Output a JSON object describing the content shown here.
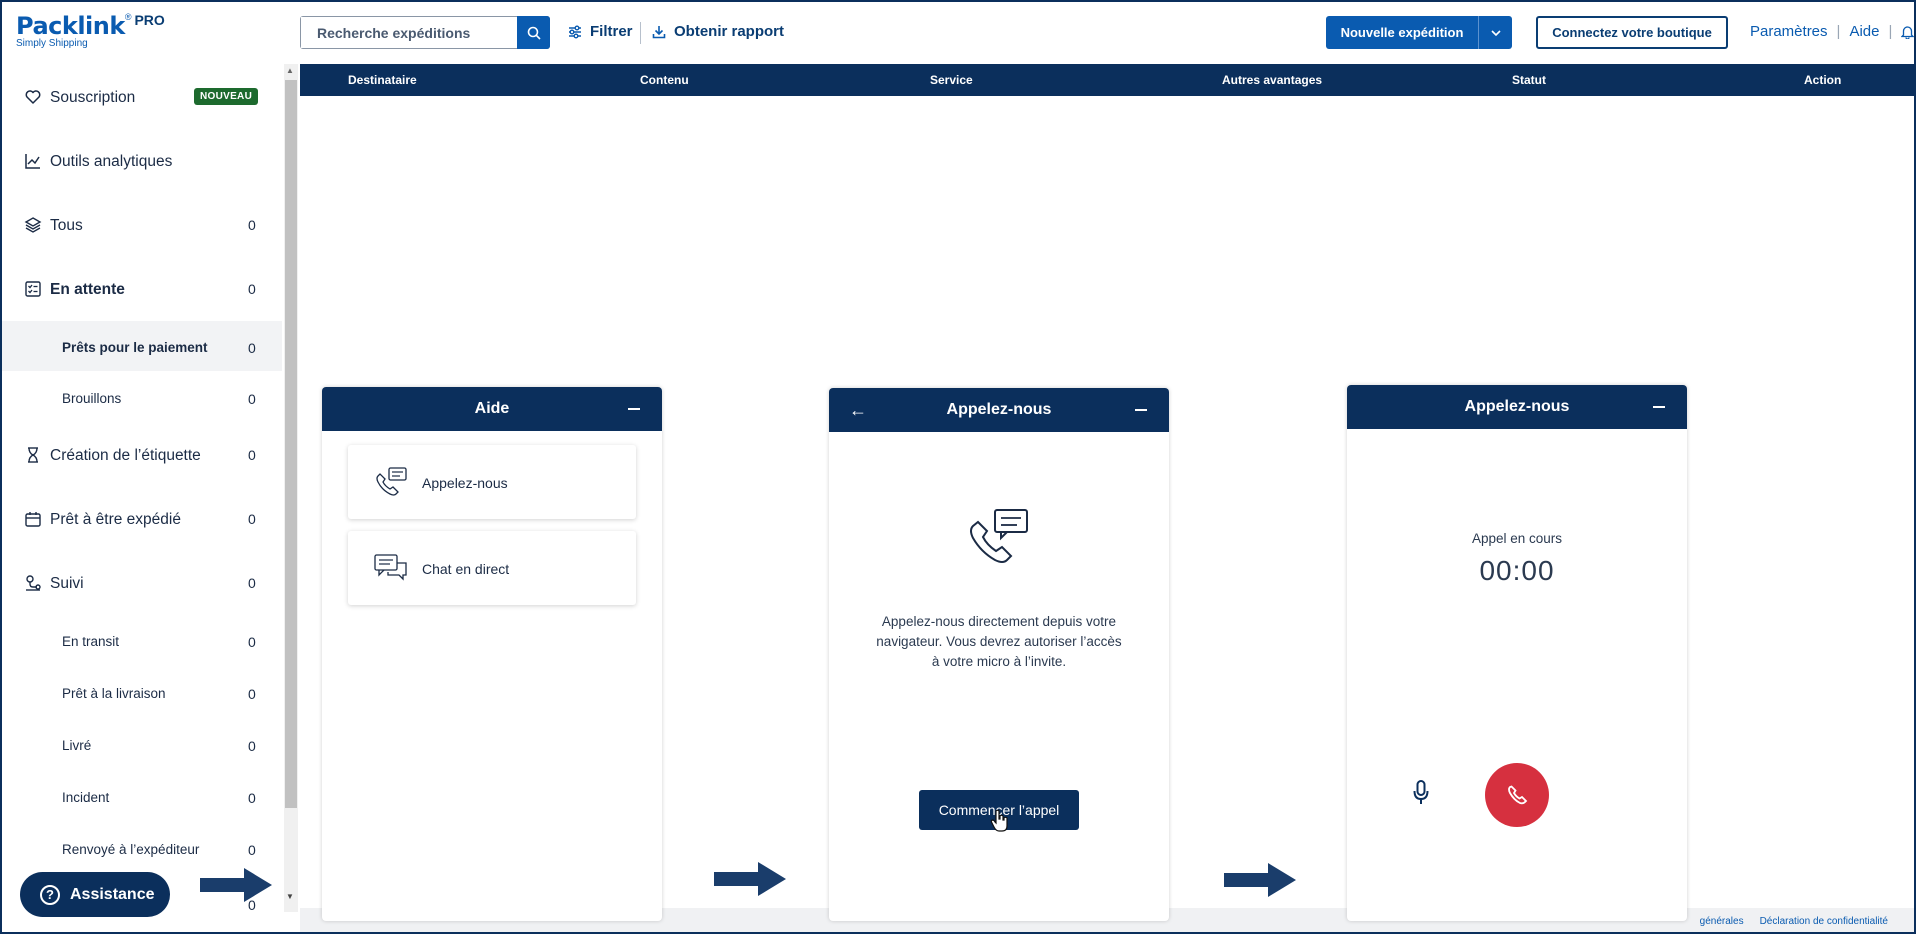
{
  "header": {
    "logo": "Packlink",
    "logo_pro": "PRO",
    "logo_tagline": "Simply Shipping",
    "search_placeholder": "Recherche expéditions",
    "filter_label": "Filtrer",
    "report_label": "Obtenir rapport",
    "new_shipment_label": "Nouvelle expédition",
    "connect_shop_label": "Connectez votre boutique",
    "settings_label": "Paramètres",
    "help_label": "Aide"
  },
  "table": {
    "columns": [
      "Destinataire",
      "Contenu",
      "Service",
      "Autres avantages",
      "Statut",
      "Action"
    ]
  },
  "sidebar": {
    "badge": "NOUVEAU",
    "items": [
      {
        "label": "Souscription",
        "count": ""
      },
      {
        "label": "Outils analytiques",
        "count": ""
      },
      {
        "label": "Tous",
        "count": "0"
      },
      {
        "label": "En attente",
        "count": "0"
      },
      {
        "label": "Prêts pour le paiement",
        "count": "0"
      },
      {
        "label": "Brouillons",
        "count": "0"
      },
      {
        "label": "Création de l’étiquette",
        "count": "0"
      },
      {
        "label": "Prêt à être expédié",
        "count": "0"
      },
      {
        "label": "Suivi",
        "count": "0"
      },
      {
        "label": "En transit",
        "count": "0"
      },
      {
        "label": "Prêt à la livraison",
        "count": "0"
      },
      {
        "label": "Livré",
        "count": "0"
      },
      {
        "label": "Incident",
        "count": "0"
      },
      {
        "label": "Renvoyé à l’expéditeur",
        "count": "0"
      },
      {
        "label": "",
        "count": "0"
      }
    ],
    "assistance_label": "Assistance"
  },
  "panel_help": {
    "title": "Aide",
    "call_label": "Appelez-nous",
    "chat_label": "Chat en direct"
  },
  "panel_call": {
    "title": "Appelez-nous",
    "description_lines": [
      "Appelez-nous directement depuis votre",
      "navigateur. Vous devrez autoriser l’accès",
      "à votre micro à l’invite."
    ],
    "start_button": "Commencer l’appel"
  },
  "panel_active": {
    "title": "Appelez-nous",
    "status": "Appel en cours",
    "timer": "00:00"
  },
  "footer": {
    "terms": "générales",
    "privacy": "Déclaration de confidentialité"
  },
  "colors": {
    "navy": "#0b2f5c",
    "brand_blue": "#0a5bb0",
    "badge_green": "#1d6a2e",
    "hangup_red": "#d6303f"
  }
}
